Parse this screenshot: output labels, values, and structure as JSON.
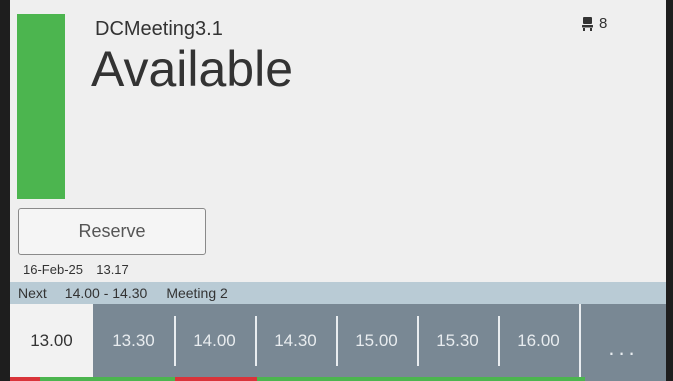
{
  "room": {
    "name": "DCMeeting3.1",
    "status": "Available",
    "status_color": "#4cb54f",
    "capacity": "8",
    "capacity_icon": "seat-icon"
  },
  "reserve": {
    "label": "Reserve"
  },
  "datetime": {
    "date": "16-Feb-25",
    "time": "13.17"
  },
  "next": {
    "label": "Next",
    "time": "14.00 - 14.30",
    "title": "Meeting 2"
  },
  "timeline": {
    "slots": [
      "13.00",
      "13.30",
      "14.00",
      "14.30",
      "15.00",
      "15.30",
      "16.00"
    ],
    "more_label": "..."
  },
  "colors": {
    "free": "#4cb54f",
    "busy": "#d9343a",
    "next_bar": "#b9cbd5",
    "timeline_bg": "#798894"
  }
}
